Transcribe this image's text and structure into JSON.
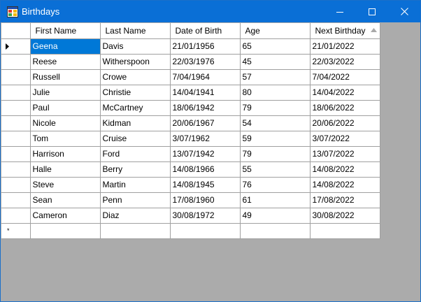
{
  "window": {
    "title": "Birthdays"
  },
  "grid": {
    "columns": [
      "First Name",
      "Last Name",
      "Date of Birth",
      "Age",
      "Next Birthday"
    ],
    "sorted_column": "Next Birthday",
    "sort_direction": "ascending",
    "selected_row": 0,
    "selected_column": 0,
    "rows": [
      [
        "Geena",
        "Davis",
        "21/01/1956",
        "65",
        "21/01/2022"
      ],
      [
        "Reese",
        "Witherspoon",
        "22/03/1976",
        "45",
        "22/03/2022"
      ],
      [
        "Russell",
        "Crowe",
        "7/04/1964",
        "57",
        "7/04/2022"
      ],
      [
        "Julie",
        "Christie",
        "14/04/1941",
        "80",
        "14/04/2022"
      ],
      [
        "Paul",
        "McCartney",
        "18/06/1942",
        "79",
        "18/06/2022"
      ],
      [
        "Nicole",
        "Kidman",
        "20/06/1967",
        "54",
        "20/06/2022"
      ],
      [
        "Tom",
        "Cruise",
        "3/07/1962",
        "59",
        "3/07/2022"
      ],
      [
        "Harrison",
        "Ford",
        "13/07/1942",
        "79",
        "13/07/2022"
      ],
      [
        "Halle",
        "Berry",
        "14/08/1966",
        "55",
        "14/08/2022"
      ],
      [
        "Steve",
        "Martin",
        "14/08/1945",
        "76",
        "14/08/2022"
      ],
      [
        "Sean",
        "Penn",
        "17/08/1960",
        "61",
        "17/08/2022"
      ],
      [
        "Cameron",
        "Diaz",
        "30/08/1972",
        "49",
        "30/08/2022"
      ]
    ],
    "new_row_marker": "*"
  },
  "colors": {
    "titlebar": "#0a6fd6",
    "selection": "#0078d7",
    "grid_background": "#ffffff",
    "empty_area": "#ababab",
    "gridlines": "#a0a0a0"
  }
}
